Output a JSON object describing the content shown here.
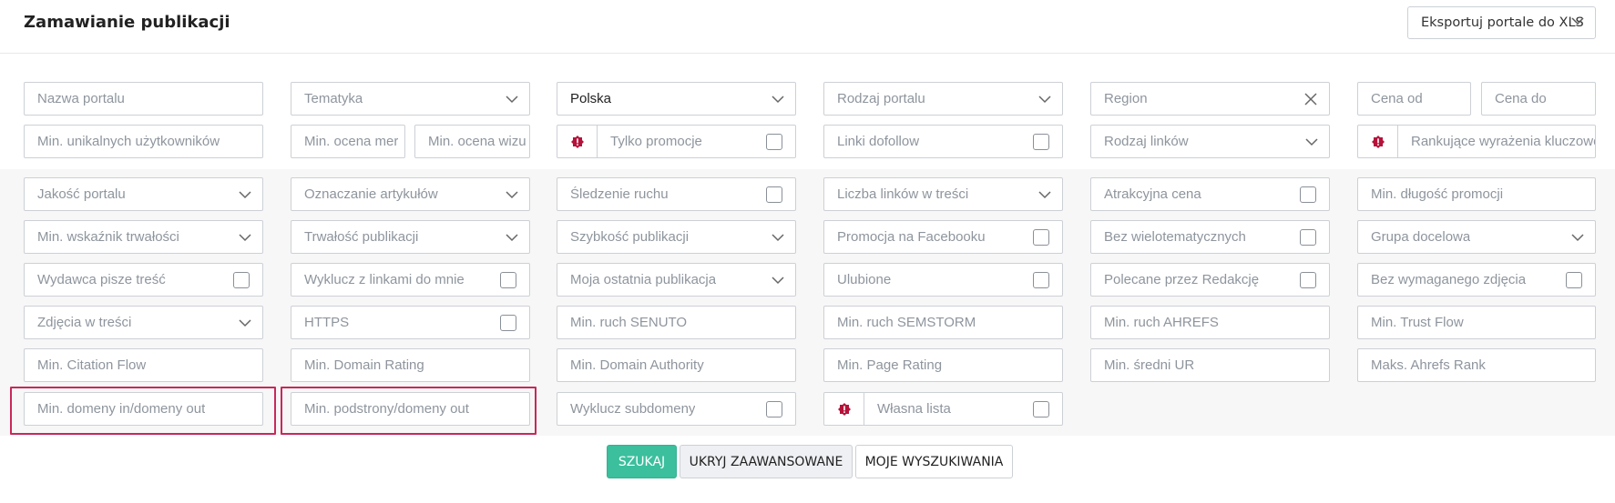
{
  "header": {
    "title": "Zamawianie publikacji",
    "export_label": "Eksportuj portale do XLS"
  },
  "filters": {
    "portal_name": "Nazwa portalu",
    "topic": "Tematyka",
    "country": "Polska",
    "portal_type": "Rodzaj portalu",
    "region": "Region",
    "price_from": "Cena od",
    "price_to": "Cena do",
    "min_unique_users": "Min. unikalnych użytkowników",
    "min_merit_rating": "Min. ocena mer",
    "min_visual_rating": "Min. ocena wizu",
    "only_promotions": "Tylko promocje",
    "dofollow_links": "Linki dofollow",
    "link_type": "Rodzaj linków",
    "ranking_keywords": "Rankujące wyrażenia kluczowe"
  },
  "advanced": {
    "portal_quality": "Jakość portalu",
    "article_marking": "Oznaczanie artykułów",
    "traffic_tracking": "Śledzenie ruchu",
    "links_in_content": "Liczba linków w treści",
    "attractive_price": "Atrakcyjna cena",
    "min_promo_length": "Min. długość promocji",
    "min_durability_index": "Min. wskaźnik trwałości",
    "publication_durability": "Trwałość publikacji",
    "publication_speed": "Szybkość publikacji",
    "facebook_promotion": "Promocja na Facebooku",
    "no_multitopic": "Bez wielotematycznych",
    "target_group": "Grupa docelowa",
    "publisher_writes": "Wydawca pisze treść",
    "exclude_linking_to_me": "Wyklucz z linkami do mnie",
    "my_last_publication": "Moja ostatnia publikacja",
    "favorites": "Ulubione",
    "recommended_by_editors": "Polecane przez Redakcję",
    "no_required_photo": "Bez wymaganego zdjęcia",
    "photos_in_content": "Zdjęcia w treści",
    "https": "HTTPS",
    "min_senuto": "Min. ruch SENUTO",
    "min_semstorm": "Min. ruch SEMSTORM",
    "min_ahrefs": "Min. ruch AHREFS",
    "min_trust_flow": "Min. Trust Flow",
    "min_citation_flow": "Min. Citation Flow",
    "min_domain_rating": "Min. Domain Rating",
    "min_domain_authority": "Min. Domain Authority",
    "min_page_rating": "Min. Page Rating",
    "min_avg_ur": "Min. średni UR",
    "max_ahrefs_rank": "Maks. Ahrefs Rank",
    "min_domains_in_out": "Min. domeny in/domeny out",
    "min_subpages_out": "Min. podstrony/domeny out",
    "exclude_subdomains": "Wyklucz subdomeny",
    "own_list": "Własna lista"
  },
  "actions": {
    "search": "SZUKAJ",
    "hide_advanced": "UKRYJ ZAAWANSOWANE",
    "my_searches": "MOJE WYSZUKIWANIA"
  },
  "colors": {
    "accent": "#3bbf9d",
    "highlight": "#c8285a",
    "badge": "#b5123a"
  }
}
